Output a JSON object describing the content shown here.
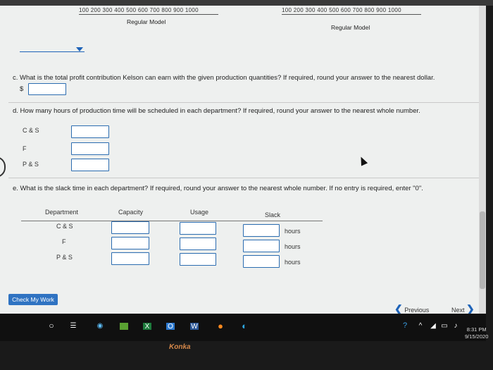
{
  "chart_axes": {
    "ticks": "100  200  300  400  500  600  700  800  900  1000",
    "left_label": "Regular Model",
    "right_label": "Regular Model"
  },
  "question_c": {
    "text": "c. What is the total profit contribution Kelson can earn with the given production quantities? If required, round your answer to the nearest dollar.",
    "prefix": "$"
  },
  "question_d": {
    "text": "d. How many hours of production time will be scheduled in each department? If required, round your answer to the nearest whole number.",
    "rows": [
      "C & S",
      "F",
      "P & S"
    ]
  },
  "question_e": {
    "text": "e. What is the slack time in each department? If required, round your answer to the nearest whole number. If no entry is required, enter \"0\".",
    "headers": {
      "department": "Department",
      "capacity": "Capacity",
      "usage": "Usage",
      "slack": "Slack"
    },
    "rows": [
      "C & S",
      "F",
      "P & S"
    ],
    "unit": "hours"
  },
  "buttons": {
    "check": "Check My Work",
    "previous": "Previous",
    "next": "Next"
  },
  "taskbar": {
    "time": "8:31 PM",
    "date": "9/15/2020"
  },
  "monitor_brand": "Konka"
}
